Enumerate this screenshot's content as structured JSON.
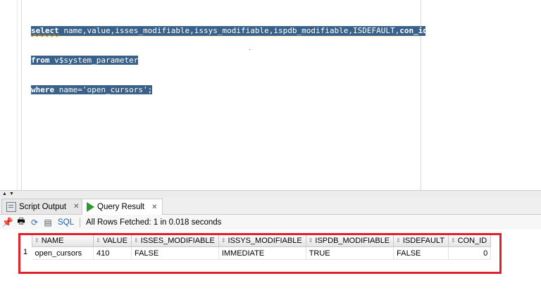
{
  "editor": {
    "lines": [
      [
        "select",
        " name,value,isses_modifiable,issys_modifiable,ispdb_modifiable,ISDEFAULT,",
        "con_id"
      ],
      [
        "from",
        " v$system_parameter"
      ],
      [
        "where",
        " name='open_cursors';"
      ]
    ]
  },
  "tabs": [
    {
      "label": "Script Output",
      "icon": "script-icon",
      "active": false
    },
    {
      "label": "Query Result",
      "icon": "play-icon",
      "active": true
    }
  ],
  "toolbar": {
    "sql_label": "SQL",
    "status": "All Rows Fetched: 1 in 0.018 seconds"
  },
  "grid": {
    "columns": [
      "NAME",
      "VALUE",
      "ISSES_MODIFIABLE",
      "ISSYS_MODIFIABLE",
      "ISPDB_MODIFIABLE",
      "ISDEFAULT",
      "CON_ID"
    ],
    "rows": [
      {
        "row_number": "1",
        "cells": [
          "open_cursors",
          "410",
          "FALSE",
          "IMMEDIATE",
          "TRUE",
          "FALSE",
          "0"
        ]
      }
    ]
  },
  "colors": {
    "selection": "#39618a",
    "highlight_box": "#e0202a",
    "sql_link": "#1d5fa6"
  }
}
